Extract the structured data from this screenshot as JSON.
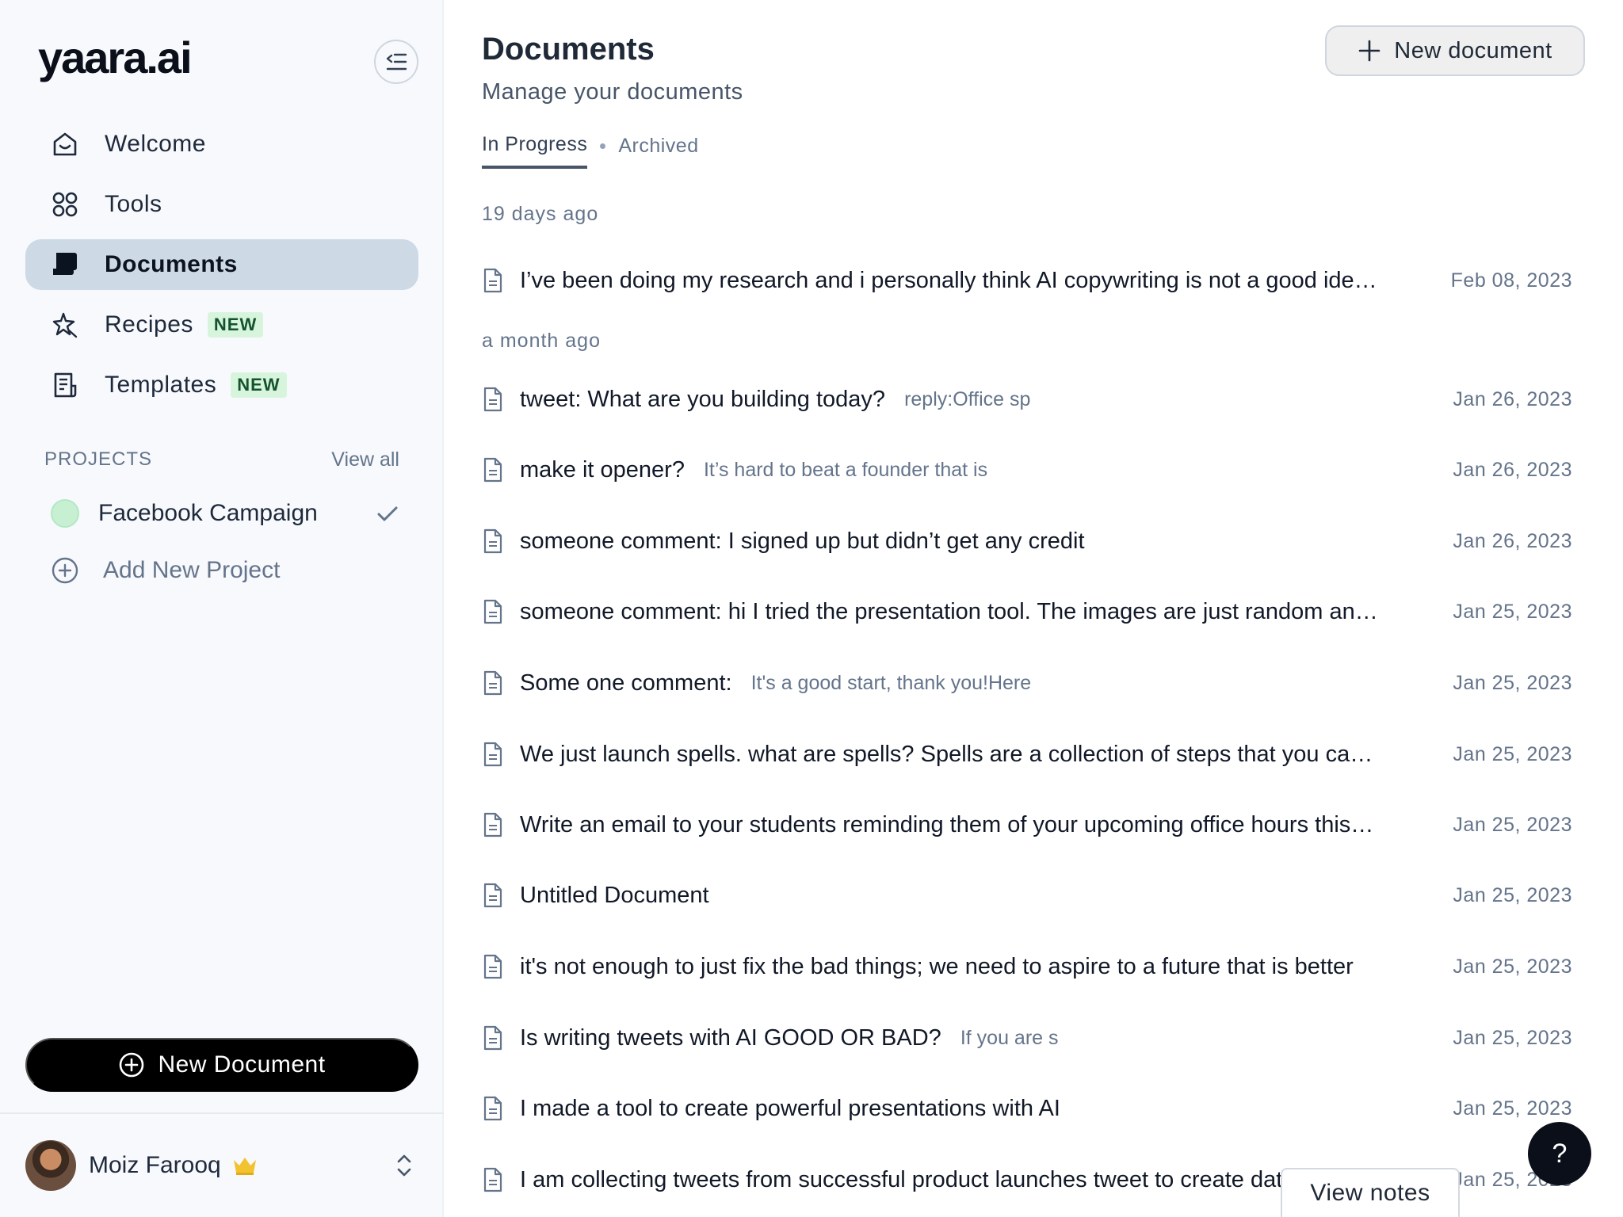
{
  "sidebar": {
    "logo": "yaara.ai",
    "nav": [
      {
        "label": "Welcome",
        "icon": "home-icon"
      },
      {
        "label": "Tools",
        "icon": "grid-icon"
      },
      {
        "label": "Documents",
        "icon": "documents-icon",
        "active": true
      },
      {
        "label": "Recipes",
        "icon": "sparkle-icon",
        "badge": "NEW"
      },
      {
        "label": "Templates",
        "icon": "template-icon",
        "badge": "NEW"
      }
    ],
    "projects_label": "PROJECTS",
    "view_all": "View all",
    "project": {
      "name": "Facebook Campaign",
      "color": "#c7f0d2"
    },
    "add_project": "Add New Project",
    "new_document": "New Document",
    "user": {
      "name": "Moiz Farooq"
    }
  },
  "main": {
    "title": "Documents",
    "subtitle": "Manage your documents",
    "new_document": "New document",
    "tabs": [
      {
        "label": "In Progress",
        "active": true
      },
      {
        "label": "Archived",
        "active": false
      }
    ],
    "groups": [
      {
        "label": "19 days ago",
        "docs": [
          {
            "title": "I’ve been doing my research and i personally think AI copywriting is not a good idea for long-form content",
            "snippet": "",
            "date": "Feb 08, 2023"
          }
        ]
      },
      {
        "label": "a month ago",
        "docs": [
          {
            "title": "tweet: What are you building today?",
            "snippet": "reply:Office sp",
            "date": "Jan 26, 2023"
          },
          {
            "title": "make it opener?",
            "snippet": "It’s hard to beat a founder that is",
            "date": "Jan 26, 2023"
          },
          {
            "title": "someone comment: I signed up but didn’t get any credit",
            "snippet": "",
            "date": "Jan 26, 2023"
          },
          {
            "title": "someone comment: hi I tried the presentation tool. The images are just random and not related",
            "snippet": "",
            "date": "Jan 25, 2023"
          },
          {
            "title": "Some one comment:",
            "snippet": "It's a good start, thank you!Here",
            "date": "Jan 25, 2023"
          },
          {
            "title": "We just launch spells. what are spells? Spells are a collection of steps that you can run",
            "snippet": "",
            "date": "Jan 25, 2023"
          },
          {
            "title": "Write an email to your students reminding them of your upcoming office hours this week",
            "snippet": "",
            "date": "Jan 25, 2023"
          },
          {
            "title": "Untitled Document",
            "snippet": "",
            "date": "Jan 25, 2023"
          },
          {
            "title": "it's not enough to just fix the bad things; we need to aspire to a future that is better",
            "snippet": "",
            "date": "Jan 25, 2023"
          },
          {
            "title": "Is writing tweets with AI GOOD OR BAD?",
            "snippet": "If you are s",
            "date": "Jan 25, 2023"
          },
          {
            "title": "I made a tool to create powerful presentations with AI",
            "snippet": "",
            "date": "Jan 25, 2023"
          },
          {
            "title": "I am collecting tweets from successful product launches tweet to create database",
            "snippet": "",
            "date": "Jan 25, 2023"
          }
        ]
      }
    ]
  },
  "help": "?",
  "view_notes": "View notes"
}
